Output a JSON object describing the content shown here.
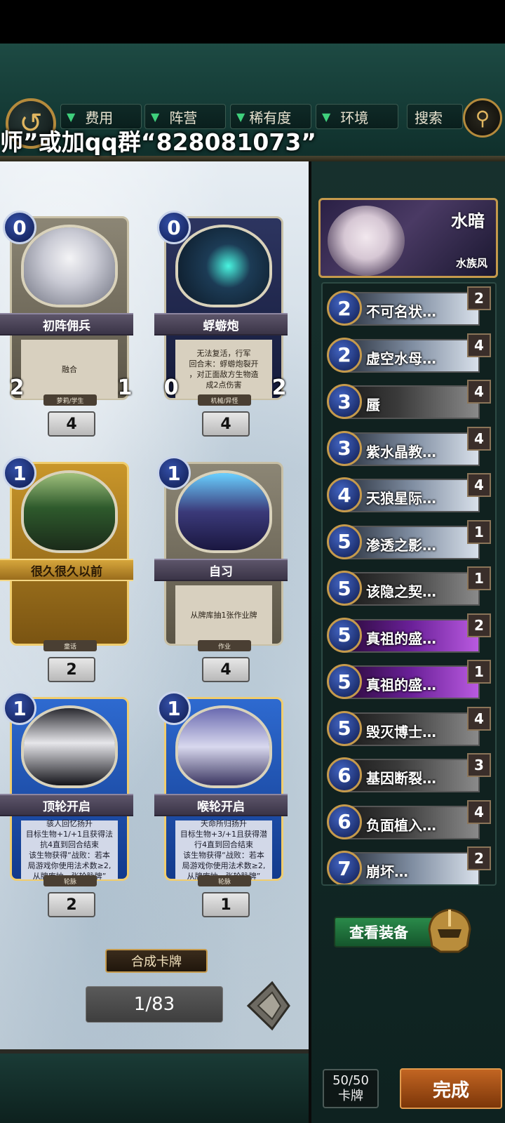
{
  "filters": {
    "cost": "费用",
    "faction": "阵营",
    "rarity": "稀有度",
    "environment": "环境",
    "search": "搜索"
  },
  "overlay_text": "师”或加qq群“828081073”",
  "cards": [
    {
      "cost": "0",
      "name": "初阵佣兵",
      "desc": "融合",
      "tag": "萝莉/学生",
      "atk": "2",
      "hp": "1",
      "count": "4",
      "style": "plain"
    },
    {
      "cost": "0",
      "name": "蜉蝣炮",
      "desc": "无法复活，行军\n回合末：蜉蝣炮裂开\n，对正面敌方生物造\n成2点伤害",
      "tag": "机械/异怪",
      "atk": "0",
      "hp": "2",
      "count": "4",
      "style": "plain-dark"
    },
    {
      "cost": "1",
      "name": "很久很久以前",
      "desc": "",
      "tag": "童话",
      "atk": "",
      "hp": "",
      "count": "2",
      "style": "gold"
    },
    {
      "cost": "1",
      "name": "自习",
      "desc": "从牌库抽1张作业牌",
      "tag": "作业",
      "atk": "",
      "hp": "",
      "count": "4",
      "style": "plain"
    },
    {
      "cost": "1",
      "name": "顶轮开启",
      "desc": "骇人回忆扬升\n目标生物+1/+1且获得法\n抗4直到回合结束\n该生物获得“战败：若本\n局游戏你使用法术数≥2,\n从牌库抽一张轮脉牌”",
      "tag": "轮脉",
      "atk": "",
      "hp": "",
      "count": "2",
      "style": "blue"
    },
    {
      "cost": "1",
      "name": "喉轮开启",
      "desc": "天命所归扬升\n目标生物+3/+1且获得潜\n行4直到回合结束\n该生物获得“战败：若本\n局游戏你使用法术数≥2,\n从牌库抽一张轮脉牌”",
      "tag": "轮脉",
      "atk": "",
      "hp": "",
      "count": "1",
      "style": "blue"
    }
  ],
  "craft_button": "合成卡牌",
  "page_indicator": "1/83",
  "deck": {
    "name": "水暗",
    "subtitle": "水族风",
    "items": [
      {
        "cost": "2",
        "name": "不可名状…",
        "count": "2",
        "tone": "light"
      },
      {
        "cost": "2",
        "name": "虚空水母…",
        "count": "4",
        "tone": "light"
      },
      {
        "cost": "3",
        "name": "蜃",
        "count": "4",
        "tone": "dark"
      },
      {
        "cost": "3",
        "name": "紫水晶教…",
        "count": "4",
        "tone": "light"
      },
      {
        "cost": "4",
        "name": "天狼星际…",
        "count": "4",
        "tone": "light"
      },
      {
        "cost": "5",
        "name": "渗透之影…",
        "count": "1",
        "tone": "light"
      },
      {
        "cost": "5",
        "name": "该隐之契…",
        "count": "1",
        "tone": "dark"
      },
      {
        "cost": "5",
        "name": "真祖的盛…",
        "count": "2",
        "tone": "purple"
      },
      {
        "cost": "5",
        "name": "真祖的盛…",
        "count": "1",
        "tone": "purple"
      },
      {
        "cost": "5",
        "name": "毁灭博士…",
        "count": "4",
        "tone": "dark"
      },
      {
        "cost": "6",
        "name": "基因断裂…",
        "count": "3",
        "tone": "dark"
      },
      {
        "cost": "6",
        "name": "负面植入…",
        "count": "4",
        "tone": "dark"
      },
      {
        "cost": "7",
        "name": "崩坏…",
        "count": "2",
        "tone": "light"
      }
    ]
  },
  "equip_button": "查看装备",
  "deck_count": {
    "value": "50/50",
    "label": "卡牌"
  },
  "done_button": "完成"
}
